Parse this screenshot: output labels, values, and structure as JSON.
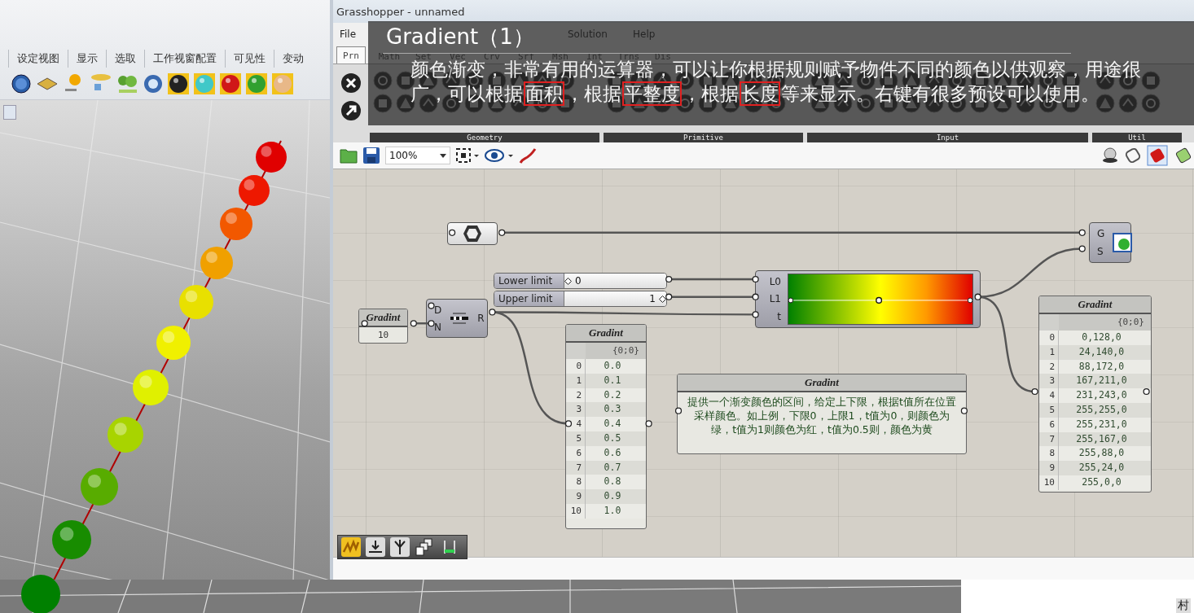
{
  "rhino": {
    "tabs": [
      "设定视图",
      "显示",
      "选取",
      "工作视窗配置",
      "可见性",
      "变动"
    ]
  },
  "grasshopper": {
    "title": "Grasshopper - unnamed",
    "menu": [
      "File",
      "Solution",
      "Help"
    ],
    "tabs": [
      {
        "label": "Prn",
        "selected": true
      },
      {
        "label": "Math",
        "selected": false
      },
      {
        "label": "Set",
        "selected": false
      },
      {
        "label": "Vec",
        "selected": false
      },
      {
        "label": "Crv",
        "selected": false
      },
      {
        "label": "Srf",
        "selected": false
      },
      {
        "label": "Msh",
        "selected": false
      },
      {
        "label": "Int",
        "selected": false
      },
      {
        "label": "Trns",
        "selected": false
      },
      {
        "label": "Dis",
        "selected": false
      }
    ],
    "ribbon_groups": [
      "Geometry",
      "Primitive",
      "Input",
      "Util"
    ],
    "zoom": "100%"
  },
  "overlay": {
    "title": "Gradient（1）",
    "caption": [
      {
        "text": "颜色渐变，非常有用的运算器，可以让你根据规则赋予物件不同的颜色以供观察，用途很广，可以根据",
        "highlighted": false
      },
      {
        "text": "面积",
        "highlighted": true
      },
      {
        "text": "，根据",
        "highlighted": false
      },
      {
        "text": "平整度",
        "highlighted": true
      },
      {
        "text": "，根据",
        "highlighted": false
      },
      {
        "text": "长度",
        "highlighted": true
      },
      {
        "text": "等来显示。右键有很多预设可以使用。",
        "highlighted": false
      }
    ]
  },
  "canvas": {
    "number_panel": {
      "title": "Gradint",
      "value": "10"
    },
    "range": {
      "inputs": [
        "D",
        "N"
      ],
      "output": "R"
    },
    "sliders": [
      {
        "label": "Lower limit",
        "value": "0",
        "level": 0
      },
      {
        "label": "Upper limit",
        "value": "1",
        "level": 1
      }
    ],
    "gradient": {
      "inputs": [
        "L0",
        "L1",
        "t"
      ]
    },
    "preview": {
      "inputs": [
        "G",
        "S"
      ]
    },
    "list_panel": {
      "title": "Gradint",
      "path": "{0;0}",
      "rows": [
        {
          "index": "0",
          "value": "0.0"
        },
        {
          "index": "1",
          "value": "0.1"
        },
        {
          "index": "2",
          "value": "0.2"
        },
        {
          "index": "3",
          "value": "0.3"
        },
        {
          "index": "4",
          "value": "0.4"
        },
        {
          "index": "5",
          "value": "0.5"
        },
        {
          "index": "6",
          "value": "0.6"
        },
        {
          "index": "7",
          "value": "0.7"
        },
        {
          "index": "8",
          "value": "0.8"
        },
        {
          "index": "9",
          "value": "0.9"
        },
        {
          "index": "10",
          "value": "1.0"
        }
      ]
    },
    "note_panel": {
      "title": "Gradint",
      "text": "提供一个渐变颜色的区间，给定上下限，根据t值所在位置采样颜色。如上例，下限0，上限1，t值为0，则颜色为绿，t值为1则颜色为红，t值为0.5则，颜色为黄"
    },
    "color_panel": {
      "title": "Gradint",
      "path": "{0;0}",
      "rows": [
        {
          "index": "0",
          "value": "0,128,0"
        },
        {
          "index": "1",
          "value": "24,140,0"
        },
        {
          "index": "2",
          "value": "88,172,0"
        },
        {
          "index": "3",
          "value": "167,211,0"
        },
        {
          "index": "4",
          "value": "231,243,0"
        },
        {
          "index": "5",
          "value": "255,255,0"
        },
        {
          "index": "6",
          "value": "255,231,0"
        },
        {
          "index": "7",
          "value": "255,167,0"
        },
        {
          "index": "8",
          "value": "255,88,0"
        },
        {
          "index": "9",
          "value": "255,24,0"
        },
        {
          "index": "10",
          "value": "255,0,0"
        }
      ]
    }
  },
  "corner_text": "村"
}
